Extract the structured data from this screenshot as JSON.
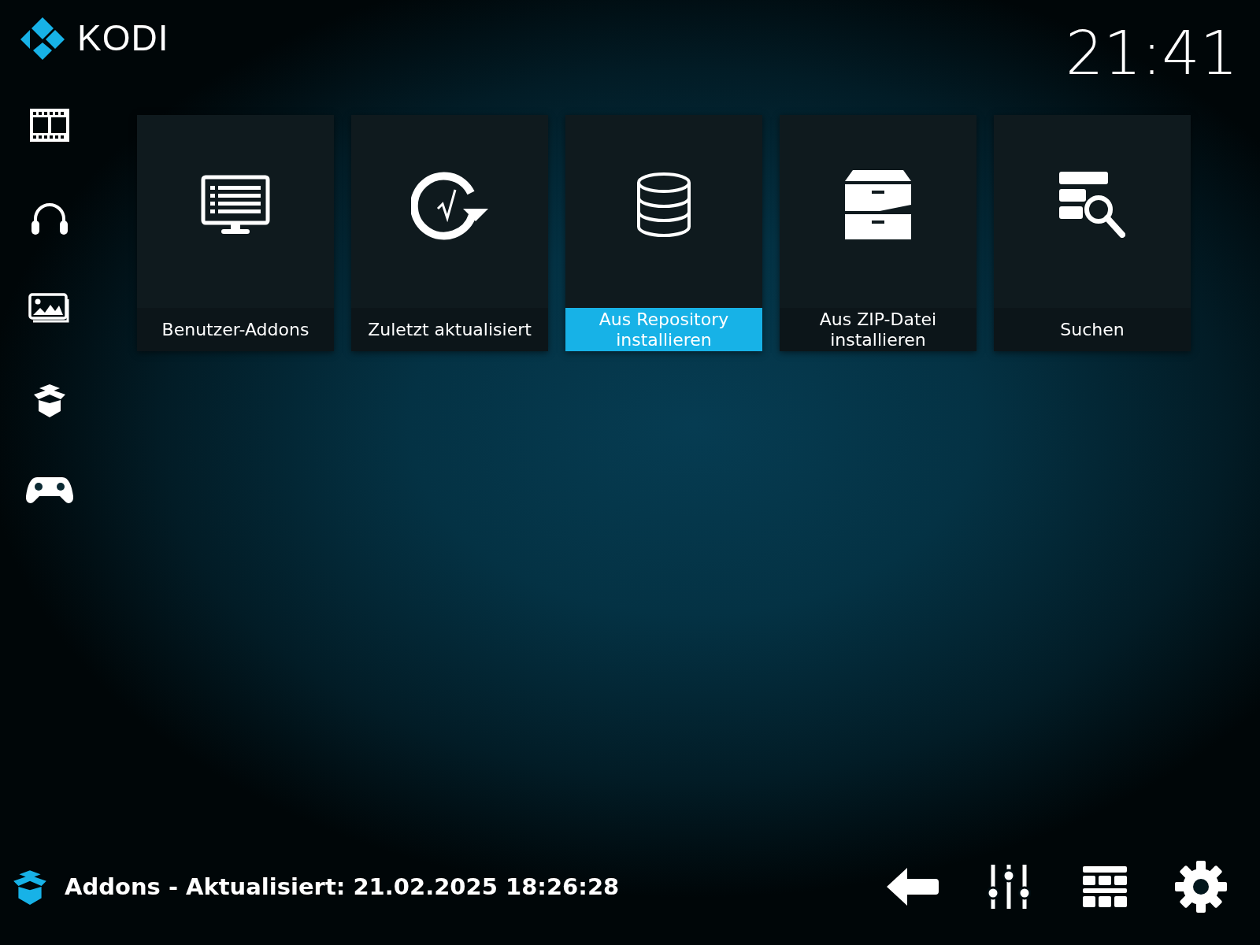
{
  "header": {
    "logo_text": "KODI",
    "clock": "21:41"
  },
  "sidebar": {
    "items": [
      {
        "kind": "movies"
      },
      {
        "kind": "music"
      },
      {
        "kind": "pictures"
      },
      {
        "kind": "addons"
      },
      {
        "kind": "games"
      }
    ]
  },
  "tiles": [
    {
      "label": "Benutzer-Addons",
      "kind": "monitor",
      "selected": false
    },
    {
      "label": "Zuletzt aktualisiert",
      "kind": "update",
      "selected": false
    },
    {
      "label": "Aus Repository installieren",
      "kind": "database",
      "selected": true
    },
    {
      "label": "Aus ZIP-Datei installieren",
      "kind": "cabinet",
      "selected": false
    },
    {
      "label": "Suchen",
      "kind": "search",
      "selected": false
    }
  ],
  "status_bar": {
    "text": "Addons - Aktualisiert: 21.02.2025 18:26:28",
    "buttons": [
      {
        "kind": "back"
      },
      {
        "kind": "filters"
      },
      {
        "kind": "view"
      },
      {
        "kind": "settings"
      }
    ]
  }
}
